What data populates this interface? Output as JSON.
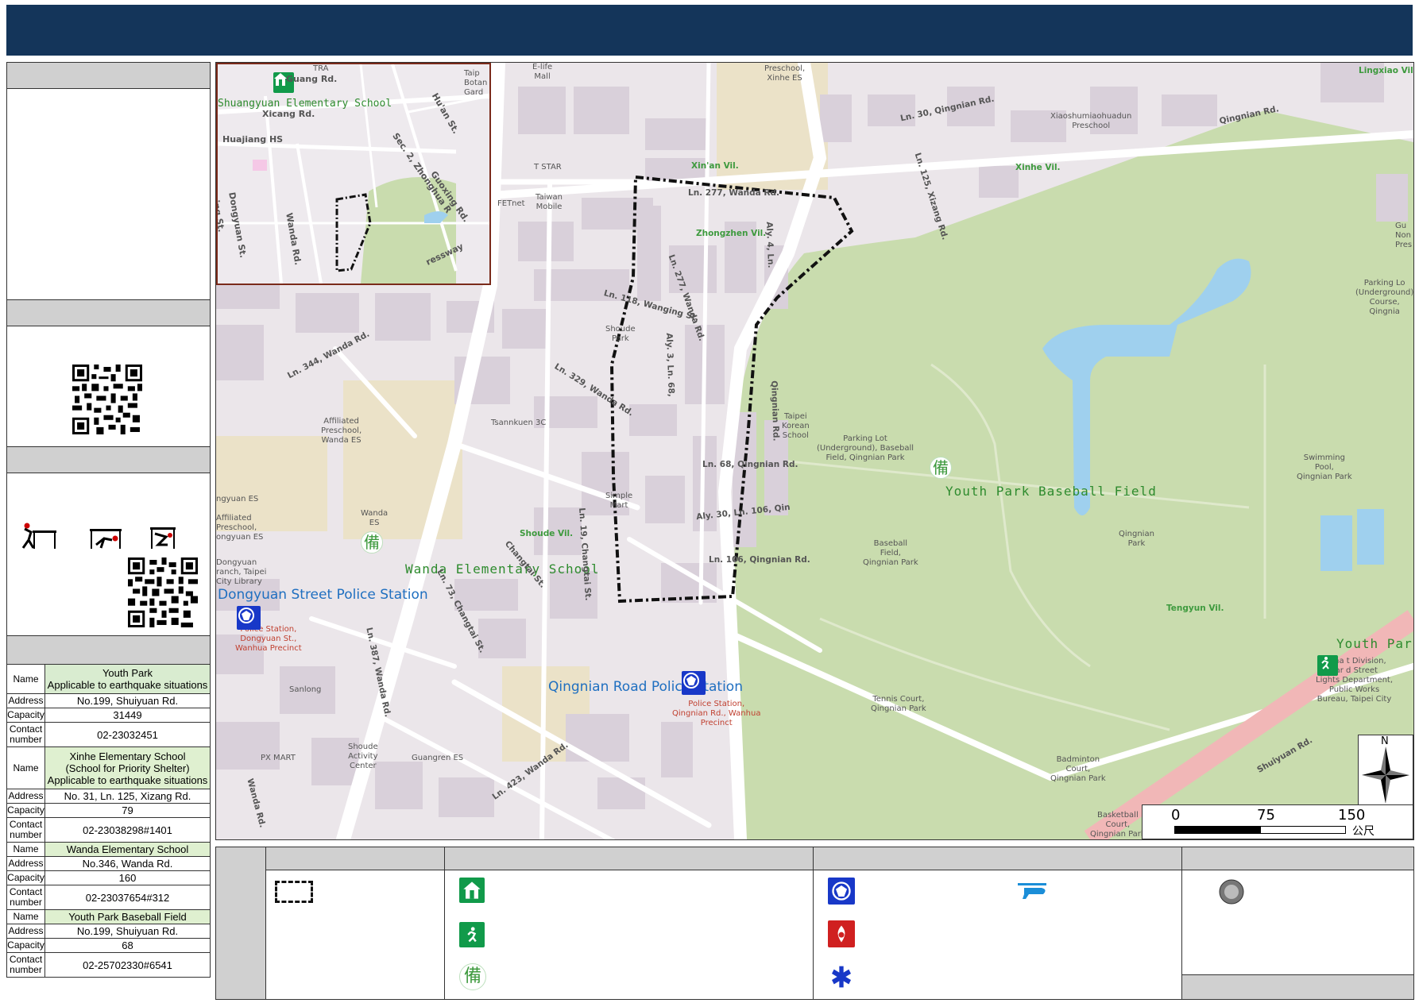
{
  "map": {
    "inset": {
      "school_label": "Shuangyuan Elementary School",
      "streets": [
        "Guang Rd.",
        "Xicang Rd.",
        "Huajiang HS",
        "Dongyuan St.",
        "Wanda Rd.",
        "Sec. 2, Zhonghua R",
        "Guoxing Rd.",
        "Hu'an St.",
        "TRA",
        "Taip Botan Gard",
        "ing St.",
        "ressway"
      ]
    },
    "labels": {
      "shuangyuan": "Shuangyuan Elementary School",
      "wanda_school": "Wanda Elementary School",
      "youth_park_baseball": "Youth Park Baseball Field",
      "youth_park": "Youth Park",
      "dongyuan_police": "Dongyuan Street Police Station",
      "qingnian_police": "Qingnian Road Police Station"
    },
    "streets": [
      "Ln. 30, Qingnian Rd.",
      "Qingnian Rd.",
      "Ln. 277, Wanda Rd.",
      "Ln. 118, Wanging St.",
      "Ln. 344, Wanda Rd.",
      "Ln. 329, Wanda Rd.",
      "Ln. 68, Qingnian Rd.",
      "Ln. 106, Qingnian Rd.",
      "Aly. 30, Ln. 106, Qin",
      "Ln. 387, Wanda Rd.",
      "Ln. 73, Changtai St.",
      "Ln. 19, Changtai St.",
      "Changtai St.",
      "Ln. 423, Wanda Rd.",
      "Shuiyuan Rd.",
      "Ln. 125, Xizang Rd.",
      "Ln. 277, Wanda Rd.",
      "Aly. 3, Ln. 68,",
      "Qingnian Rd.",
      "Aly. 4, Ln.",
      "Wanda Rd."
    ],
    "villages": [
      "Xin'an Vil.",
      "Xinhe Vil.",
      "Zhongzhen Vil.",
      "Shoude Vil.",
      "Tengyun Vil.",
      "Lingxiao Vil."
    ],
    "pois": {
      "e_life": "E-life\nMall",
      "t_star": "T STAR",
      "taiwan_mobile": "Taiwan\nMobile",
      "fetnet": "FETnet",
      "preschool_top": "Preschool,\nXinhe ES",
      "xiaoshumiao": "Xiaoshumiaohuadun\nPreschool",
      "shoude_park": "Shoude\nPark",
      "tsannkuen": "Tsannkuen 3C",
      "affiliated_wanda": "Affiliated\nPreschool,\nWanda ES",
      "wanda_es": "Wanda\nES",
      "affiliated_dongyuan": "ngyuan ES\n\nAffiliated\nPreschool,\nongyuan ES",
      "library": "Dongyuan\nranch, Taipei\nCity Library",
      "simple_mart": "Simple\nMart",
      "korean_school": "Taipei\nKorean\nSchool",
      "parking_lot": "Parking Lot\n(Underground), Baseball\nField, Qingnian Park",
      "baseball": "Baseball\nField,\nQingnian Park",
      "qingnian_park": "Qingnian\nPark",
      "swimming": "Swimming\nPool,\nQingnian Park",
      "parking_right": "Parking Lo\n(Underground)\nCourse, Qingnia",
      "police_dongyuan": "Police Station,\nDongyuan St.,\nWanhua Precinct",
      "police_qingnian": "Police Station,\nQingnian Rd., Wanhua\nPrecinct",
      "sanlong": "Sanlong",
      "px_mart": "PX MART",
      "shoude_activity": "Shoude\nActivity\nCenter",
      "guangren": "Guangren ES",
      "tennis": "Tennis Court,\nQingnian Park",
      "badminton": "Badminton\nCourt,\nQingnian Park",
      "basketball": "Basketball\nCourt,\nQingnian Park",
      "mgmt": "Mana    t Division,\nPar       d Street\nLights Department,\nPublic Works\nBureau, Taipei City",
      "gu_non": "Gu\nNon\nPres"
    },
    "scale": {
      "ticks": [
        "0",
        "75",
        "150"
      ],
      "unit": "公尺"
    },
    "north": "N"
  },
  "legend_symbols": {
    "reserve_char": "備"
  },
  "shelters": [
    {
      "name_lines": [
        "Youth Park",
        "Applicable to earthquake situations"
      ],
      "address": "No.199, Shuiyuan Rd.",
      "capacity": "31449",
      "contact": "02-23032451"
    },
    {
      "name_lines": [
        "Xinhe Elementary School",
        "(School for Priority Shelter)",
        "Applicable to earthquake situations"
      ],
      "address": "No. 31, Ln. 125, Xizang Rd.",
      "capacity": "79",
      "contact": "02-23038298#1401"
    },
    {
      "name_lines": [
        "Wanda Elementary School"
      ],
      "address": "No.346, Wanda Rd.",
      "capacity": "160",
      "contact": "02-23037654#312"
    },
    {
      "name_lines": [
        "Youth Park Baseball Field"
      ],
      "address": "No.199, Shuiyuan Rd.",
      "capacity": "68",
      "contact": "02-25702330#6541"
    }
  ],
  "table_keys": {
    "name": "Name",
    "address": "Address",
    "capacity": "Capacity",
    "contact": "Contact\nnumber"
  }
}
